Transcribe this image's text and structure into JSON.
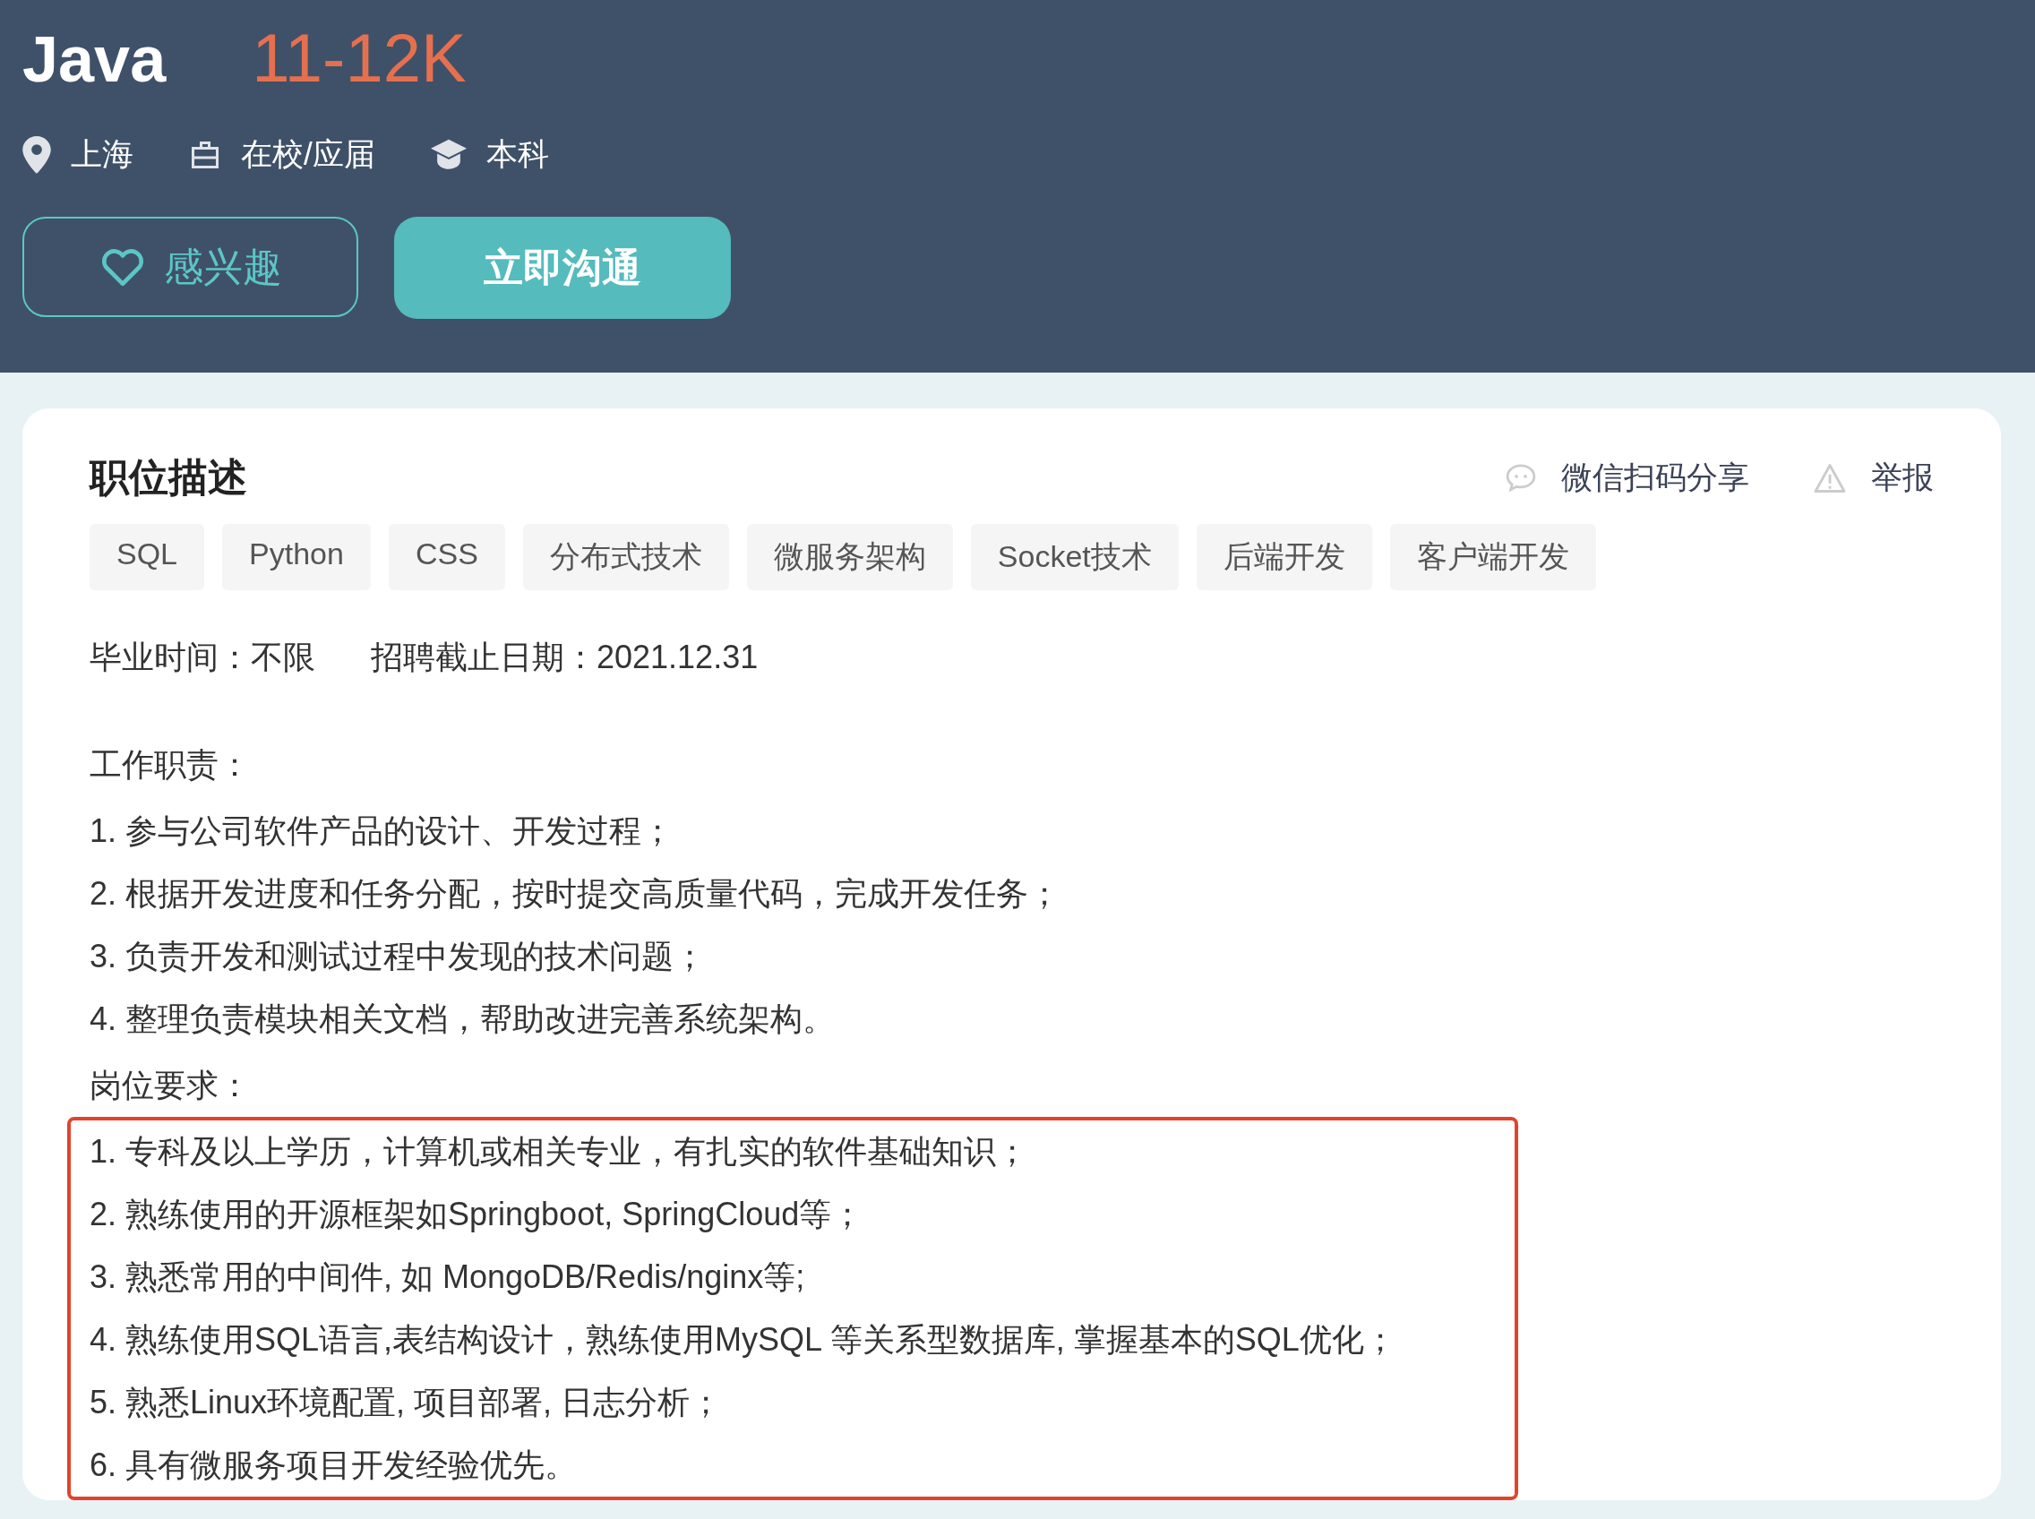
{
  "job": {
    "title": "Java",
    "salary": "11-12K",
    "meta": [
      {
        "kind": "location",
        "label": "上海"
      },
      {
        "kind": "experience",
        "label": "在校/应届"
      },
      {
        "kind": "education",
        "label": "本科"
      }
    ]
  },
  "actions": [
    {
      "kind": "interest",
      "label": "感兴趣"
    },
    {
      "kind": "chat",
      "label": "立即沟通"
    }
  ],
  "description": {
    "heading": "职位描述",
    "links": [
      {
        "kind": "share",
        "label": "微信扫码分享"
      },
      {
        "kind": "report",
        "label": "举报"
      }
    ],
    "tags": [
      "SQL",
      "Python",
      "CSS",
      "分布式技术",
      "微服务架构",
      "Socket技术",
      "后端开发",
      "客户端开发"
    ],
    "info": [
      "毕业时间：不限",
      "招聘截止日期：2021.12.31"
    ],
    "sections": [
      {
        "heading": "工作职责：",
        "highlighted": false,
        "items": [
          "1. 参与公司软件产品的设计、开发过程；",
          "2. 根据开发进度和任务分配，按时提交高质量代码，完成开发任务；",
          "3. 负责开发和测试过程中发现的技术问题；",
          "4. 整理负责模块相关文档，帮助改进完善系统架构。"
        ]
      },
      {
        "heading": "岗位要求：",
        "highlighted": true,
        "items": [
          "1. 专科及以上学历，计算机或相关专业，有扎实的软件基础知识；",
          "2. 熟练使用的开源框架如Springboot, SpringCloud等；",
          "3. 熟悉常用的中间件, 如 MongoDB/Redis/nginx等;",
          "4. 熟练使用SQL语言,表结构设计，熟练使用MySQL 等关系型数据库, 掌握基本的SQL优化；",
          "5. 熟悉Linux环境配置, 项目部署, 日志分析；",
          "6. 具有微服务项目开发经验优先。"
        ]
      }
    ]
  }
}
